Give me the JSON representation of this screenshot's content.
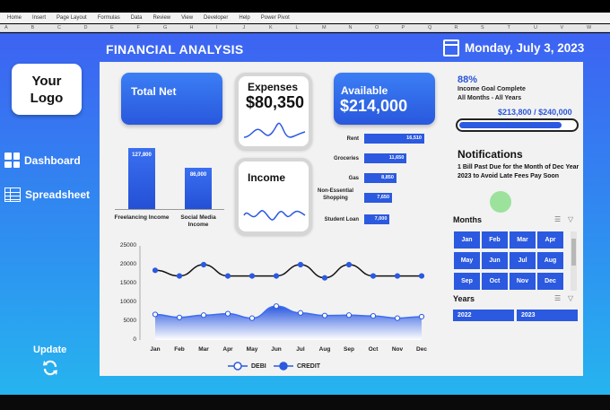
{
  "ribbon": [
    "Home",
    "Insert",
    "Page Layout",
    "Formulas",
    "Data",
    "Review",
    "View",
    "Developer",
    "Help",
    "Power Pivot"
  ],
  "columns": [
    "A",
    "B",
    "C",
    "D",
    "E",
    "F",
    "G",
    "H",
    "I",
    "J",
    "K",
    "L",
    "M",
    "N",
    "O",
    "P",
    "Q",
    "R",
    "S",
    "T",
    "U",
    "V",
    "W"
  ],
  "header": {
    "title": "FINANCIAL ANALYSIS",
    "date": "Monday, July 3, 2023"
  },
  "logo": {
    "line1": "Your",
    "line2": "Logo"
  },
  "nav": {
    "dashboard": "Dashboard",
    "spreadsheet": "Spreadsheet",
    "update": "Update"
  },
  "kpis": {
    "total_net": "Total Net",
    "expenses_label": "Expenses",
    "expenses_value": "$80,350",
    "available_label": "Available",
    "available_value": "$214,000",
    "income_label": "Income"
  },
  "goal": {
    "percent": "88%",
    "line1": "Income Goal Complete",
    "line2": "All Months - All Years",
    "current": "$213,800",
    "separator": "/",
    "target": "$240,000",
    "progress": 0.88
  },
  "notifications": {
    "title": "Notifications",
    "text": "1 Bill Past Due for the Month of Dec Year 2023 to Avoid Late Fees Pay Soon"
  },
  "months_slicer": {
    "title": "Months",
    "items": [
      "Jan",
      "Feb",
      "Mar",
      "Apr",
      "May",
      "Jun",
      "Jul",
      "Aug",
      "Sep",
      "Oct",
      "Nov",
      "Dec"
    ]
  },
  "years_slicer": {
    "title": "Years",
    "items": [
      "2022",
      "2023"
    ]
  },
  "colors": {
    "accent": "#2b59df",
    "gradient_top": "#3d63f2",
    "gradient_bottom": "#26b4ef"
  },
  "chart_data": [
    {
      "type": "bar",
      "categories": [
        "Freelancing Income",
        "Social Media Income"
      ],
      "values": [
        127800,
        86000
      ],
      "value_labels": [
        "127,800",
        "86,000"
      ],
      "ylim": [
        0,
        135000
      ]
    },
    {
      "type": "bar",
      "orientation": "horizontal",
      "categories": [
        "Rent",
        "Groceries",
        "Gas",
        "Non-Essential Shopping",
        "Student Loan"
      ],
      "values": [
        16510,
        11650,
        8850,
        7650,
        7000
      ],
      "value_labels": [
        "16,510",
        "11,650",
        "8,850",
        "7,650",
        "7,000"
      ],
      "xlim": [
        0,
        17000
      ]
    },
    {
      "type": "line",
      "categories": [
        "Jan",
        "Feb",
        "Mar",
        "Apr",
        "May",
        "Jun",
        "Jul",
        "Aug",
        "Sep",
        "Oct",
        "Nov",
        "Dec"
      ],
      "series": [
        {
          "name": "DEBI",
          "type": "area",
          "values": [
            6800,
            6000,
            6600,
            7000,
            5800,
            9000,
            7200,
            6500,
            6600,
            6400,
            5800,
            6200
          ]
        },
        {
          "name": "CREDIT",
          "type": "line",
          "values": [
            18500,
            17000,
            20000,
            17000,
            17000,
            17000,
            20000,
            16500,
            20000,
            17000,
            17000,
            17000
          ]
        }
      ],
      "yticks": [
        "25000",
        "20000",
        "15000",
        "10000",
        "5000",
        "0"
      ],
      "ylim": [
        0,
        25000
      ],
      "legend": "bottom"
    }
  ]
}
